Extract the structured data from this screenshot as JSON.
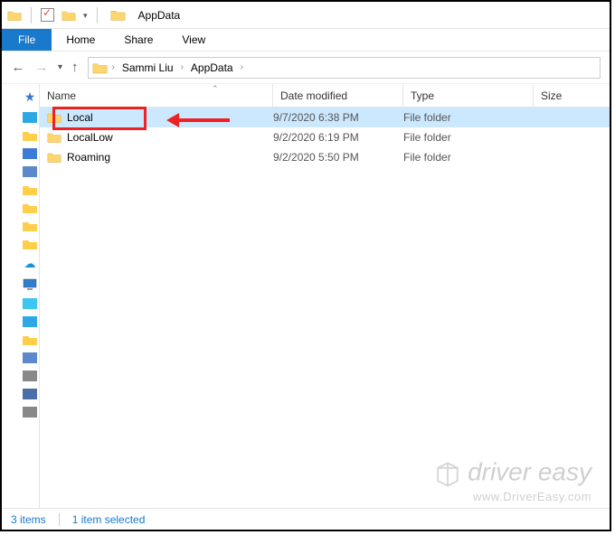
{
  "window": {
    "title": "AppData"
  },
  "ribbon": {
    "file": "File",
    "tabs": [
      "Home",
      "Share",
      "View"
    ]
  },
  "breadcrumb": {
    "items": [
      "Sammi Liu",
      "AppData"
    ]
  },
  "columns": {
    "name": "Name",
    "date": "Date modified",
    "type": "Type",
    "size": "Size"
  },
  "files": [
    {
      "name": "Local",
      "date": "9/7/2020 6:38 PM",
      "type": "File folder",
      "selected": true
    },
    {
      "name": "LocalLow",
      "date": "9/2/2020 6:19 PM",
      "type": "File folder",
      "selected": false
    },
    {
      "name": "Roaming",
      "date": "9/2/2020 5:50 PM",
      "type": "File folder",
      "selected": false
    }
  ],
  "status": {
    "count": "3 items",
    "selection": "1 item selected"
  },
  "watermark": {
    "brand": "driver easy",
    "url": "www.DriverEasy.com"
  }
}
